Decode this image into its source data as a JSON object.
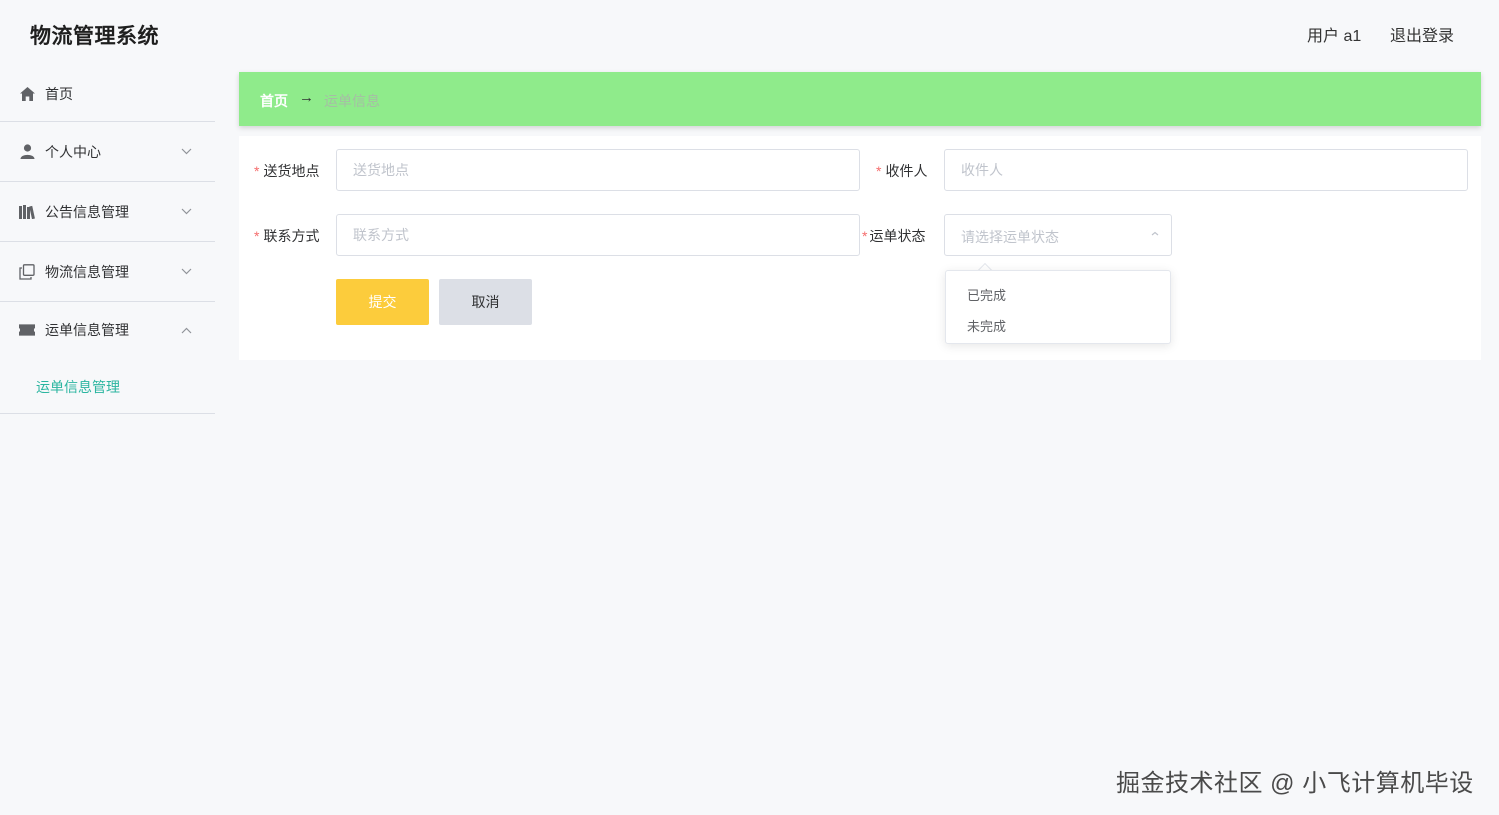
{
  "header": {
    "app_title": "物流管理系统",
    "user_label": "用户 a1",
    "logout_label": "退出登录"
  },
  "sidebar": {
    "items": [
      {
        "label": "首页",
        "icon": "home-icon"
      },
      {
        "label": "个人中心",
        "icon": "user-icon"
      },
      {
        "label": "公告信息管理",
        "icon": "books-icon"
      },
      {
        "label": "物流信息管理",
        "icon": "copy-icon"
      },
      {
        "label": "运单信息管理",
        "icon": "ticket-icon"
      }
    ],
    "sub_item": "运单信息管理",
    "active_color": "#2bb5a0"
  },
  "breadcrumb": {
    "home": "首页",
    "separator": "→",
    "current": "运单信息"
  },
  "form": {
    "fields": {
      "address": {
        "label": "送货地点",
        "placeholder": "送货地点"
      },
      "recipient": {
        "label": "收件人",
        "placeholder": "收件人"
      },
      "contact": {
        "label": "联系方式",
        "placeholder": "联系方式"
      },
      "status": {
        "label": "运单状态",
        "placeholder": "请选择运单状态"
      }
    },
    "required_mark": "*",
    "submit_label": "提交",
    "cancel_label": "取消"
  },
  "dropdown": {
    "options": [
      "已完成",
      "未完成"
    ]
  },
  "watermark": "掘金技术社区 @ 小飞计算机毕设",
  "colors": {
    "breadcrumb_bg": "#8feb8b",
    "submit_bg": "#fccc3c",
    "cancel_bg": "#dcdfe6",
    "required": "#f56c6c"
  }
}
